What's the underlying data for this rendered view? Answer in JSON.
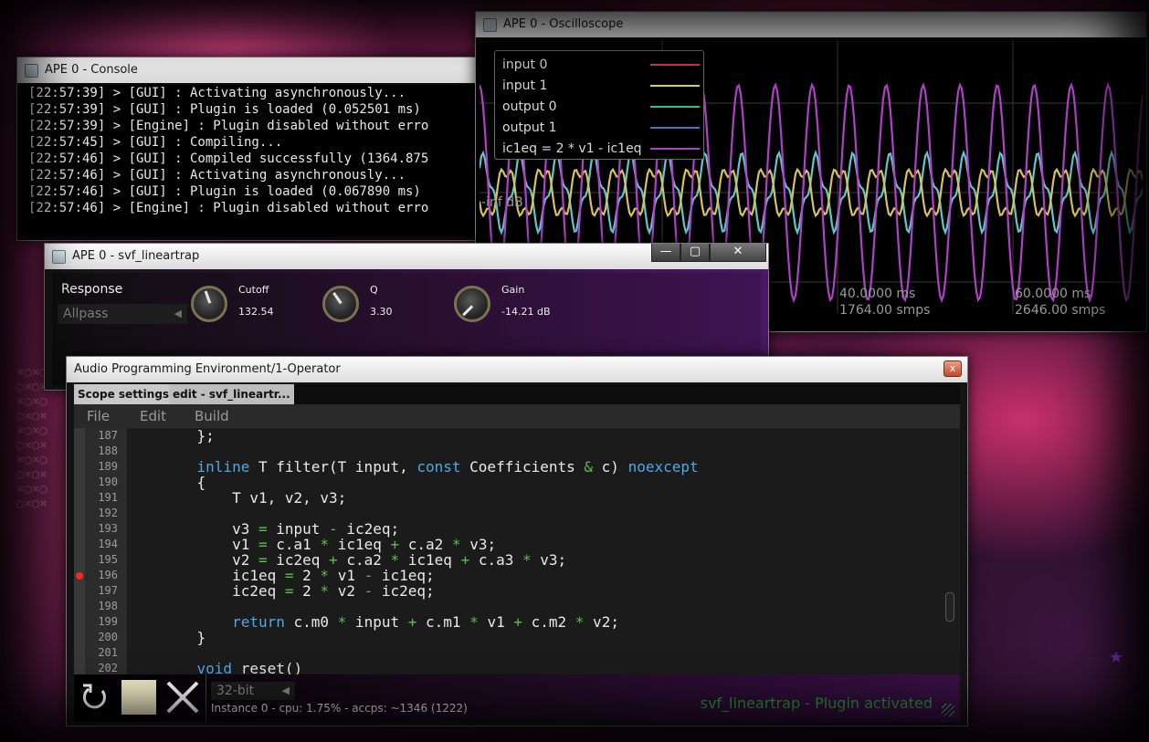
{
  "console": {
    "title": "APE 0 - Console",
    "lines": [
      "[22:57:39] > [GUI] : Activating asynchronously...",
      "[22:57:39] > [GUI] : Plugin is loaded (0.052501 ms)",
      "[22:57:39] > [Engine] : Plugin disabled without erro",
      "[22:57:45] > [GUI] : Compiling...",
      "[22:57:46] > [GUI] : Compiled successfully (1364.875",
      "[22:57:46] > [GUI] : Activating asynchronously...",
      "[22:57:46] > [GUI] : Plugin is loaded (0.067890 ms)",
      "[22:57:46] > [Engine] : Plugin disabled without erro"
    ]
  },
  "scope": {
    "title": "APE 0 - Oscilloscope",
    "legend": [
      {
        "label": "input 0",
        "color": "#d83a3a"
      },
      {
        "label": "input 1",
        "color": "#d8d24a"
      },
      {
        "label": "output 0",
        "color": "#2ec27a"
      },
      {
        "label": "output 1",
        "color": "#3a78c8"
      },
      {
        "label": "ic1eq = 2 * v1 - ic1eq",
        "color": "#b040c8"
      }
    ],
    "axis_label_db": "-inf dB",
    "time_labels": [
      {
        "ms": "40.0000 ms",
        "smps": "1764.00 smps"
      },
      {
        "ms": "60.0000 ms",
        "smps": "2646.00 smps"
      }
    ],
    "trace_colors": {
      "purple": "#b040c8",
      "yellow": "#d8c45a",
      "cyan": "#5ec8d0"
    }
  },
  "plugin": {
    "title": "APE 0 - svf_lineartrap",
    "window_buttons": {
      "minimize": "—",
      "restore": "▢",
      "close": "✕"
    },
    "response": {
      "title": "Response",
      "value": "Allpass",
      "arrow": "◀"
    },
    "params": [
      {
        "name": "Cutoff",
        "value": "132.54"
      },
      {
        "name": "Q",
        "value": "3.30"
      },
      {
        "name": "Gain",
        "value": "-14.21 dB"
      }
    ]
  },
  "main": {
    "title": "Audio Programming Environment/1-Operator",
    "close_label": "x",
    "tabs": [
      "Scope settings",
      "edit  - svf_lineartr..."
    ],
    "menu": [
      "File",
      "Edit",
      "Build"
    ],
    "code_lines": [
      {
        "n": "187",
        "text": "    };",
        "bp": false
      },
      {
        "n": "188",
        "text": "",
        "bp": false
      },
      {
        "n": "189",
        "text": "    inline T filter(T input, const Coefficients & c) noexcept",
        "bp": false
      },
      {
        "n": "190",
        "text": "    {",
        "bp": false
      },
      {
        "n": "191",
        "text": "        T v1, v2, v3;",
        "bp": false
      },
      {
        "n": "192",
        "text": "",
        "bp": false
      },
      {
        "n": "193",
        "text": "        v3 = input - ic2eq;",
        "bp": false
      },
      {
        "n": "194",
        "text": "        v1 = c.a1 * ic1eq + c.a2 * v3;",
        "bp": false
      },
      {
        "n": "195",
        "text": "        v2 = ic2eq + c.a2 * ic1eq + c.a3 * v3;",
        "bp": false
      },
      {
        "n": "196",
        "text": "        ic1eq = 2 * v1 - ic1eq;",
        "bp": true
      },
      {
        "n": "197",
        "text": "        ic2eq = 2 * v2 - ic2eq;",
        "bp": false
      },
      {
        "n": "198",
        "text": "",
        "bp": false
      },
      {
        "n": "199",
        "text": "        return c.m0 * input + c.m1 * v1 + c.m2 * v2;",
        "bp": false
      },
      {
        "n": "200",
        "text": "    }",
        "bp": false
      },
      {
        "n": "201",
        "text": "",
        "bp": false
      },
      {
        "n": "202",
        "text": "    void reset()",
        "bp": false
      }
    ],
    "bitness": "32-bit",
    "bitness_arrow": "◀",
    "instance_info": "Instance 0 - cpu: 1.75% - accps: ~1346 (1222)",
    "status": "svf_lineartrap - Plugin activated"
  }
}
